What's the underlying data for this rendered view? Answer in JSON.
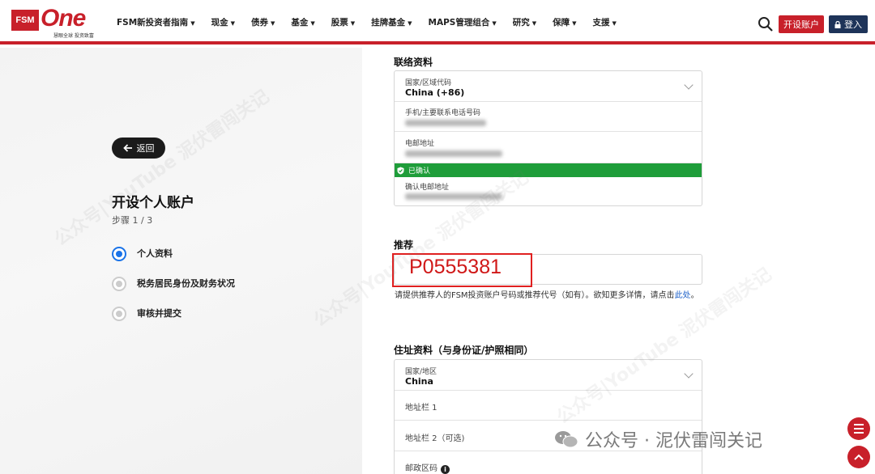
{
  "header": {
    "logo_badge": "FSM",
    "logo_word": "One",
    "logo_tagline": "慧眼全球 投资致富",
    "nav": [
      {
        "label": "FSM新投资者指南"
      },
      {
        "label": "现金"
      },
      {
        "label": "债券"
      },
      {
        "label": "基金"
      },
      {
        "label": "股票"
      },
      {
        "label": "挂牌基金"
      },
      {
        "label": "MAPS管理组合"
      },
      {
        "label": "研究"
      },
      {
        "label": "保障"
      },
      {
        "label": "支援"
      }
    ],
    "open_account_label": "开设账户",
    "login_label": "登入"
  },
  "left": {
    "back_label": "返回",
    "title": "开设个人账户",
    "step_text": "步骤 1 / 3",
    "steps": [
      {
        "label": "个人资料",
        "active": true
      },
      {
        "label": "税务居民身份及财务状况",
        "active": false
      },
      {
        "label": "审核并提交",
        "active": false
      }
    ]
  },
  "contact": {
    "title": "联络资料",
    "country_label": "国家/区域代码",
    "country_value": "China (+86)",
    "phone_label": "手机/主要联系电话号码",
    "email_label": "电邮地址",
    "confirmed_label": "已确认",
    "confirm_email_label": "确认电邮地址"
  },
  "referral": {
    "title": "推荐",
    "value": "P0555381",
    "help_text": "请提供推荐人的FSM投资账户号码或推荐代号（如有）。欲知更多详情，请点击",
    "help_link": "此处",
    "help_end": "。"
  },
  "address": {
    "title": "住址资料（与身份证/护照相同）",
    "country_label": "国家/地区",
    "country_value": "China",
    "line1_label": "地址栏 1",
    "line2_label": "地址栏 2（可选)",
    "postal_label": "邮政区码"
  },
  "watermark": {
    "text": "公众号 · 泥伏雷闯关记",
    "diagonal_text": "公众号|YouTube 泥伏雷闯关记"
  },
  "colors": {
    "brand_red": "#c8202a",
    "navy": "#1e3459",
    "confirmed_green": "#1f9d3a",
    "active_blue": "#1a73e8"
  }
}
